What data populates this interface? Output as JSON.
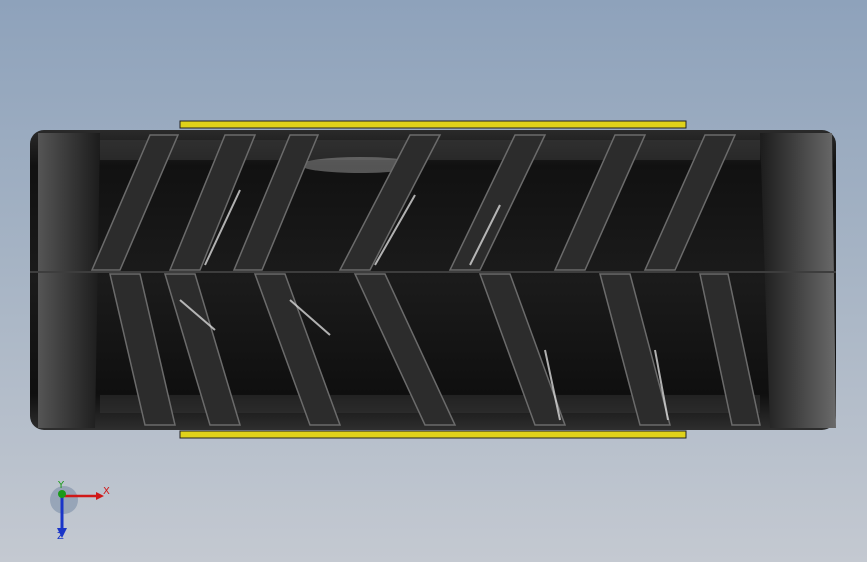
{
  "viewport": {
    "background_top": "#8ea2bb",
    "background_bottom": "#c4c9d1"
  },
  "model": {
    "rim_accent_color": "#e0d21a",
    "tread_color": "#1a1a1a"
  },
  "triad": {
    "x_label": "X",
    "y_label": "Y",
    "z_label": "Z",
    "x_color": "#d01818",
    "y_color": "#1a9a1a",
    "z_color": "#1a35c8"
  }
}
